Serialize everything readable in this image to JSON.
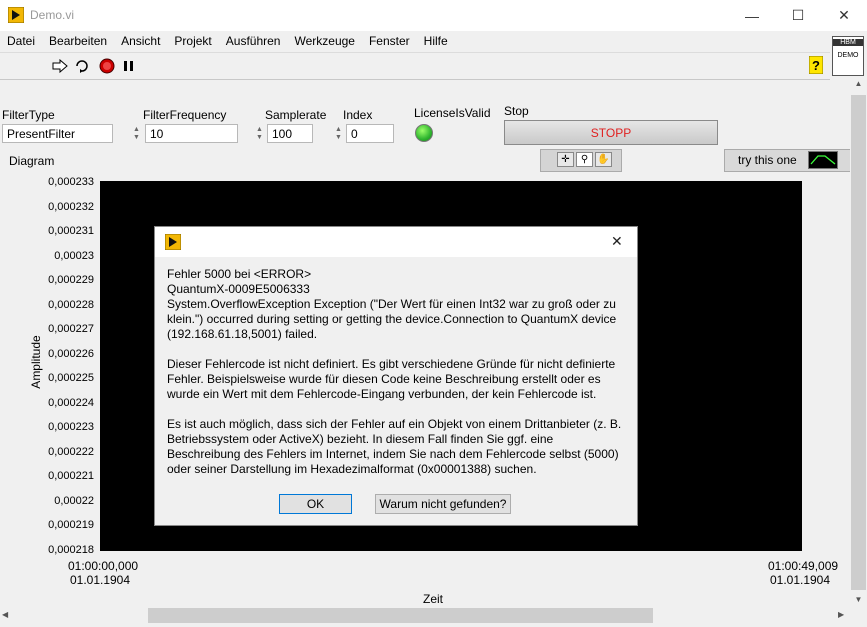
{
  "window": {
    "title": "Demo.vi",
    "minimize": "—",
    "maximize": "☐",
    "close": "✕"
  },
  "menu": [
    "Datei",
    "Bearbeiten",
    "Ansicht",
    "Projekt",
    "Ausführen",
    "Werkzeuge",
    "Fenster",
    "Hilfe"
  ],
  "demo_badge": {
    "top": "HBM",
    "bottom": "DEMO"
  },
  "controls": {
    "filter_type": {
      "label": "FilterType",
      "value": "PresentFilter"
    },
    "filter_frequency": {
      "label": "FilterFrequency",
      "value": "10"
    },
    "samplerate": {
      "label": "Samplerate",
      "value": "100"
    },
    "index": {
      "label": "Index",
      "value": "0"
    },
    "licenses_valid": {
      "label": "LicenseIsValid",
      "on": true,
      "color": "#3cc83c"
    },
    "stop": {
      "label": "Stop",
      "button_text": "STOPP",
      "text_color": "#e02020"
    }
  },
  "diagram": {
    "label": "Diagram",
    "try_label": "try this one",
    "y_axis_label": "Amplitude",
    "x_axis_label": "Zeit",
    "y_ticks": [
      "0,000233",
      "0,000232",
      "0,000231",
      "0,00023",
      "0,000229",
      "0,000228",
      "0,000227",
      "0,000226",
      "0,000225",
      "0,000224",
      "0,000223",
      "0,000222",
      "0,000221",
      "0,00022",
      "0,000219",
      "0,000218"
    ],
    "x_start": {
      "time": "01:00:00,000",
      "date": "01.01.1904"
    },
    "x_end": {
      "time": "01:00:49,009",
      "date": "01.01.1904"
    }
  },
  "dialog": {
    "message": "Fehler 5000 bei <ERROR>\nQuantumX-0009E5006333\nSystem.OverflowException Exception (\"Der Wert für einen Int32 war zu groß oder zu klein.\") occurred during setting or getting the device.Connection to QuantumX device (192.168.61.18,5001) failed.\n\nDieser Fehlercode ist nicht definiert. Es gibt verschiedene Gründe für nicht definierte Fehler. Beispielsweise wurde für diesen Code keine Beschreibung erstellt oder es wurde ein Wert mit dem Fehlercode-Eingang verbunden, der kein Fehlercode ist.\n\nEs ist auch möglich, dass sich der Fehler auf ein Objekt von einem Drittanbieter (z. B. Betriebssystem oder ActiveX) bezieht. In diesem Fall finden Sie ggf. eine Beschreibung des Fehlers im Internet, indem Sie nach dem Fehlercode selbst (5000) oder seiner Darstellung im Hexadezimalformat (0x00001388) suchen.",
    "ok_label": "OK",
    "why_label": "Warum nicht gefunden?",
    "close": "✕"
  },
  "colors": {
    "accent": "#e8b400",
    "plot_bg": "#000000",
    "stop_text": "#e02020"
  }
}
